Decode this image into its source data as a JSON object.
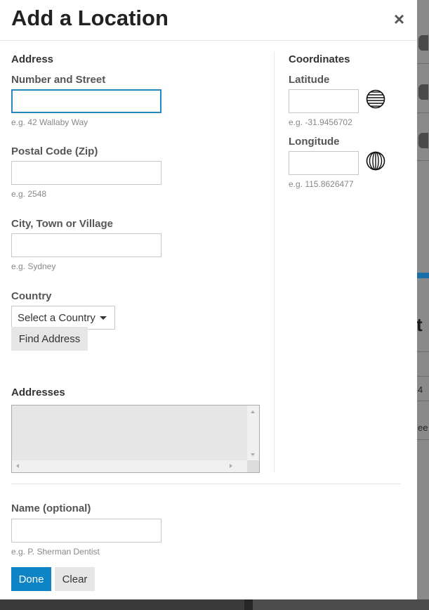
{
  "modal": {
    "title": "Add a Location",
    "close_label": "×"
  },
  "address": {
    "section_title": "Address",
    "street": {
      "label": "Number and Street",
      "value": "",
      "hint": "e.g. 42 Wallaby Way"
    },
    "postal": {
      "label": "Postal Code (Zip)",
      "value": "",
      "hint": "e.g. 2548"
    },
    "city": {
      "label": "City, Town or Village",
      "value": "",
      "hint": "e.g. Sydney"
    },
    "country": {
      "label": "Country",
      "selected": "Select a Country"
    },
    "find_button": "Find Address",
    "addresses_label": "Addresses"
  },
  "coordinates": {
    "section_title": "Coordinates",
    "latitude": {
      "label": "Latitude",
      "value": "",
      "hint": "e.g. -31.9456702",
      "icon": "latitude-globe-icon"
    },
    "longitude": {
      "label": "Longitude",
      "value": "",
      "hint": "e.g. 115.8626477",
      "icon": "longitude-globe-icon"
    }
  },
  "name": {
    "label": "Name (optional)",
    "value": "",
    "hint": "e.g. P. Sherman Dentist"
  },
  "actions": {
    "done": "Done",
    "clear": "Clear"
  },
  "background": {
    "char_four": "4",
    "char_ee": "ee",
    "char_t": "t"
  },
  "colors": {
    "primary": "#0e84c7",
    "focus": "#2a86bf"
  }
}
